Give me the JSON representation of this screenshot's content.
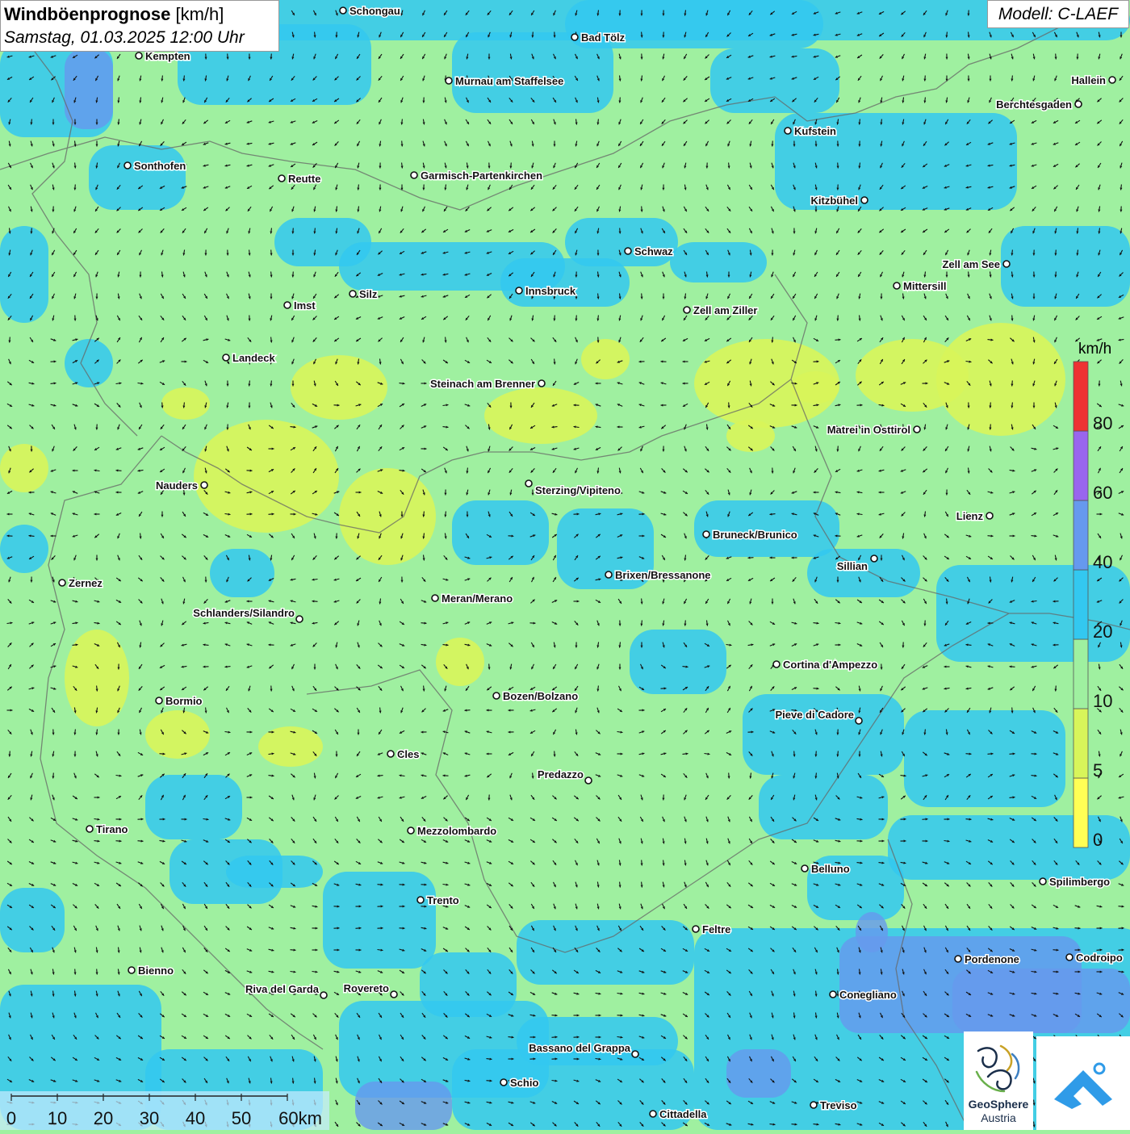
{
  "title": {
    "bold": "Windböenprognose",
    "unit": "[km/h]",
    "datetime": "Samstag, 01.03.2025 12:00 Uhr"
  },
  "model_label": "Modell: C-LAEF",
  "legend": {
    "unit": "km/h",
    "bins": [
      {
        "label": "0",
        "color": "#ffff55"
      },
      {
        "label": "5",
        "color": "#d8f55a"
      },
      {
        "label": "10",
        "color": "#9ff0a0"
      },
      {
        "label": "20",
        "color": "#33c8f0"
      },
      {
        "label": "40",
        "color": "#6699ee"
      },
      {
        "label": "60",
        "color": "#9966ee"
      },
      {
        "label": "80",
        "color": "#ee3333"
      }
    ]
  },
  "scale_bar": {
    "labels": [
      "0",
      "10",
      "20",
      "30",
      "40",
      "50",
      "60km"
    ]
  },
  "logo": {
    "org_line1": "GeoSphere",
    "org_line2": "Austria"
  },
  "places": [
    {
      "name": "Schongau"
    },
    {
      "name": "Bad Tölz"
    },
    {
      "name": "Kempten"
    },
    {
      "name": "Hallein"
    },
    {
      "name": "Murnau am Staffelsee"
    },
    {
      "name": "Berchtesgaden"
    },
    {
      "name": "Kufstein"
    },
    {
      "name": "Sonthofen"
    },
    {
      "name": "Reutte"
    },
    {
      "name": "Garmisch-Partenkirchen"
    },
    {
      "name": "Kitzbühel"
    },
    {
      "name": "Schwaz"
    },
    {
      "name": "Zell am See"
    },
    {
      "name": "Mittersill"
    },
    {
      "name": "Innsbruck"
    },
    {
      "name": "Silz"
    },
    {
      "name": "Imst"
    },
    {
      "name": "Zell am Ziller"
    },
    {
      "name": "Landeck"
    },
    {
      "name": "Steinach am Brenner"
    },
    {
      "name": "Matrei in Osttirol"
    },
    {
      "name": "Nauders"
    },
    {
      "name": "Sterzing/Vipiteno"
    },
    {
      "name": "Lienz"
    },
    {
      "name": "Bruneck/Brunico"
    },
    {
      "name": "Sillian"
    },
    {
      "name": "Brixen/Bressanone"
    },
    {
      "name": "Zernez"
    },
    {
      "name": "Meran/Merano"
    },
    {
      "name": "Schlanders/Silandro"
    },
    {
      "name": "Cortina d'Ampezzo"
    },
    {
      "name": "Bozen/Bolzano"
    },
    {
      "name": "Bormio"
    },
    {
      "name": "Pieve di Cadore"
    },
    {
      "name": "Cles"
    },
    {
      "name": "Predazzo"
    },
    {
      "name": "Tirano"
    },
    {
      "name": "Mezzolombardo"
    },
    {
      "name": "Belluno"
    },
    {
      "name": "Spilimbergo"
    },
    {
      "name": "Trento"
    },
    {
      "name": "Feltre"
    },
    {
      "name": "Pordenone"
    },
    {
      "name": "Codroipo"
    },
    {
      "name": "Bienno"
    },
    {
      "name": "Riva del Garda"
    },
    {
      "name": "Rovereto"
    },
    {
      "name": "Conegliano"
    },
    {
      "name": "Bassano del Grappa"
    },
    {
      "name": "Schio"
    },
    {
      "name": "Treviso"
    },
    {
      "name": "Cittadella"
    }
  ]
}
